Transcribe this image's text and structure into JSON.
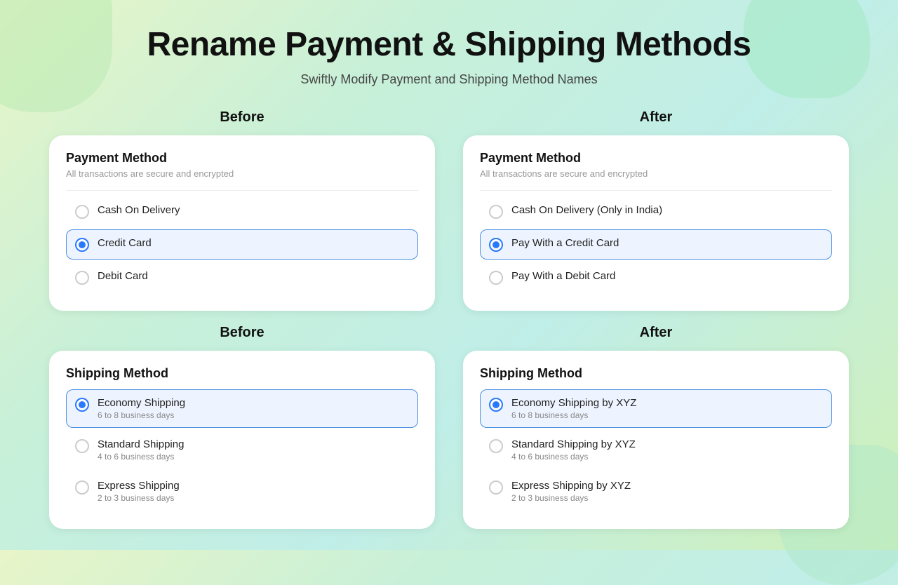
{
  "page": {
    "title": "Rename Payment & Shipping Methods",
    "subtitle": "Swiftly Modify Payment and Shipping Method Names"
  },
  "payment_section": {
    "before_label": "Before",
    "after_label": "After",
    "before_card": {
      "title": "Payment Method",
      "subtitle": "All transactions are secure and encrypted",
      "options": [
        {
          "label": "Cash On Delivery",
          "sublabel": "",
          "selected": false
        },
        {
          "label": "Credit Card",
          "sublabel": "",
          "selected": true
        },
        {
          "label": "Debit Card",
          "sublabel": "",
          "selected": false
        }
      ]
    },
    "after_card": {
      "title": "Payment Method",
      "subtitle": "All transactions are secure and encrypted",
      "options": [
        {
          "label": "Cash On Delivery (Only in India)",
          "sublabel": "",
          "selected": false
        },
        {
          "label": "Pay With a Credit Card",
          "sublabel": "",
          "selected": true
        },
        {
          "label": "Pay With a Debit Card",
          "sublabel": "",
          "selected": false
        }
      ]
    }
  },
  "shipping_section": {
    "before_label": "Before",
    "after_label": "After",
    "before_card": {
      "title": "Shipping Method",
      "options": [
        {
          "label": "Economy Shipping",
          "sublabel": "6 to 8 business days",
          "selected": true
        },
        {
          "label": "Standard Shipping",
          "sublabel": "4 to 6 business days",
          "selected": false
        },
        {
          "label": "Express Shipping",
          "sublabel": "2 to 3 business days",
          "selected": false
        }
      ]
    },
    "after_card": {
      "title": "Shipping Method",
      "options": [
        {
          "label": "Economy Shipping by XYZ",
          "sublabel": "6 to 8 business days",
          "selected": true
        },
        {
          "label": "Standard Shipping by XYZ",
          "sublabel": "4 to 6 business days",
          "selected": false
        },
        {
          "label": "Express Shipping by XYZ",
          "sublabel": "2 to 3 business days",
          "selected": false
        }
      ]
    }
  }
}
